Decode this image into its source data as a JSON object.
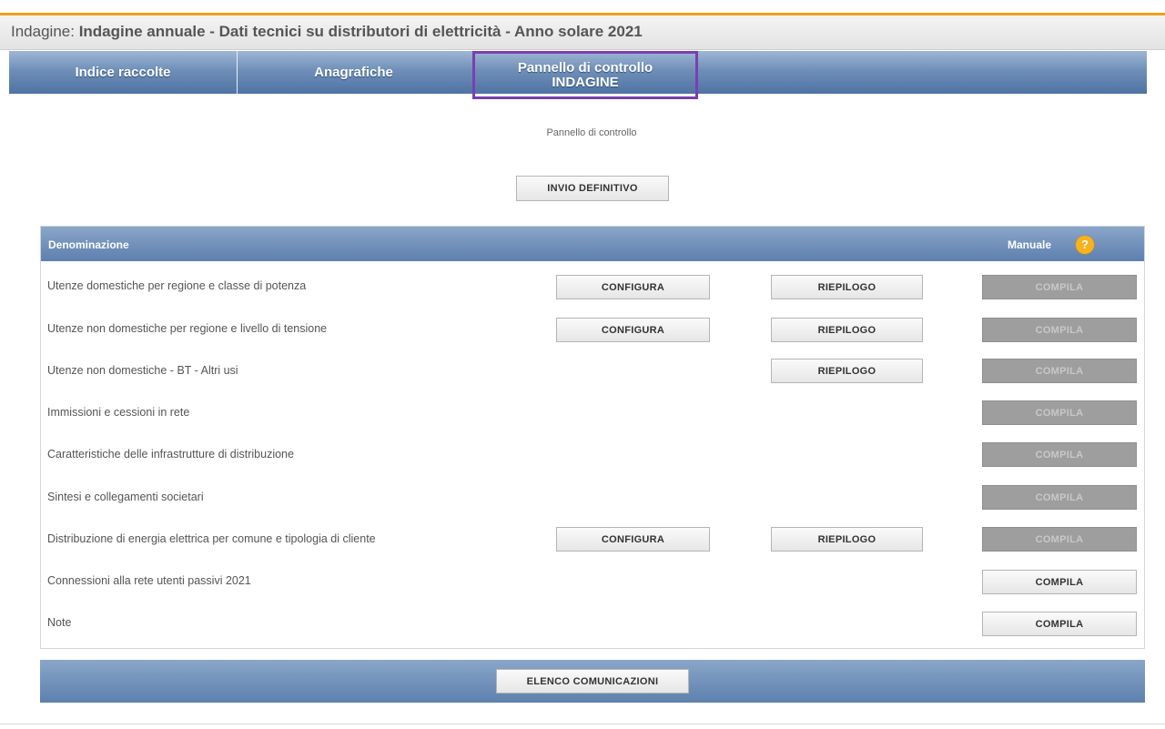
{
  "window": {
    "survey_label": "Indagine:",
    "survey_title": "Indagine annuale - Dati tecnici su distributori di elettricità - Anno solare 2021"
  },
  "nav": {
    "tabs": [
      {
        "label": "Indice raccolte"
      },
      {
        "label": "Anagrafiche"
      },
      {
        "label_line1": "Pannello di controllo",
        "label_line2": "INDAGINE"
      }
    ],
    "active_tab": "Pannello di controllo INDAGINE"
  },
  "page": {
    "subtitle": "Pannello di controllo",
    "submit_button": "INVIO DEFINITIVO"
  },
  "table": {
    "header_name": "Denominazione",
    "header_manual": "Manuale",
    "help_icon": "?",
    "rows": [
      {
        "name": "Utenze domestiche per regione e classe di potenza",
        "configura": "CONFIGURA",
        "riepilogo": "RIEPILOGO",
        "compila": "COMPILA",
        "compila_enabled": false
      },
      {
        "name": "Utenze non domestiche per regione e livello di tensione",
        "configura": "CONFIGURA",
        "riepilogo": "RIEPILOGO",
        "compila": "COMPILA",
        "compila_enabled": false
      },
      {
        "name": "Utenze non domestiche - BT - Altri usi",
        "riepilogo": "RIEPILOGO",
        "compila": "COMPILA",
        "compila_enabled": false
      },
      {
        "name": "Immissioni e cessioni in rete",
        "compila": "COMPILA",
        "compila_enabled": false
      },
      {
        "name": "Caratteristiche delle infrastrutture di distribuzione",
        "compila": "COMPILA",
        "compila_enabled": false
      },
      {
        "name": "Sintesi e collegamenti societari",
        "compila": "COMPILA",
        "compila_enabled": false
      },
      {
        "name": "Distribuzione di energia elettrica per comune e tipologia di cliente",
        "configura": "CONFIGURA",
        "riepilogo": "RIEPILOGO",
        "compila": "COMPILA",
        "compila_enabled": false
      },
      {
        "name": "Connessioni alla rete utenti passivi 2021",
        "compila": "COMPILA",
        "compila_enabled": true
      },
      {
        "name": "Note",
        "compila": "COMPILA",
        "compila_enabled": true
      }
    ]
  },
  "footer": {
    "communications_button": "ELENCO COMUNICAZIONI"
  },
  "colors": {
    "header_blue": "#5d80ae",
    "active_tab_border": "#7b3fb0",
    "accent_orange": "#f0a020",
    "help_icon": "#f7b21c",
    "disabled_button": "#9e9e9e"
  }
}
